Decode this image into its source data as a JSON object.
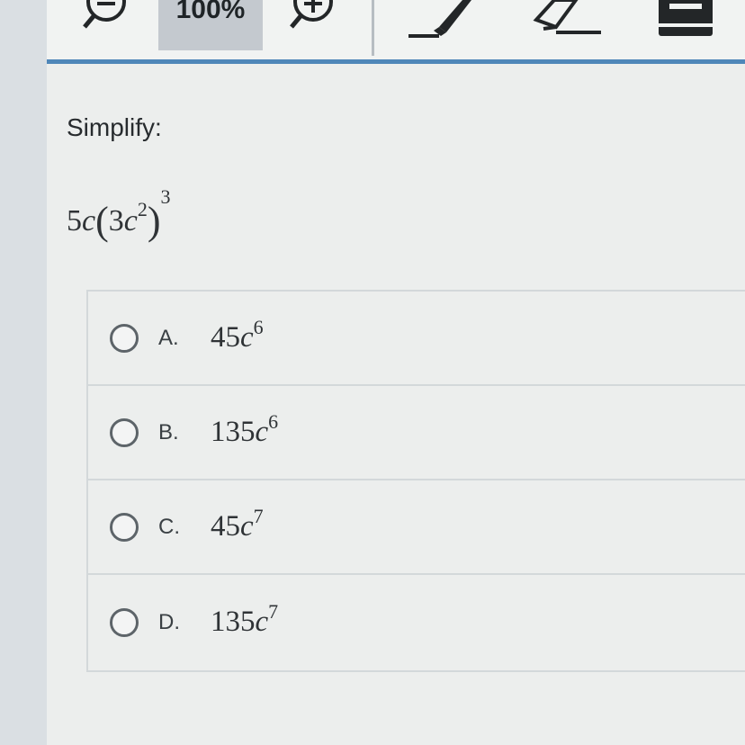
{
  "toolbar": {
    "zoom_level": "100%",
    "tools": [
      "zoom-out-icon",
      "zoom-in-icon",
      "highlighter-icon",
      "eraser-icon",
      "calculator-icon"
    ]
  },
  "colors": {
    "accent": "#4f87b9",
    "toolbar_bg": "#f1f3f2",
    "zoom_box": "#c4c9cf"
  },
  "question": {
    "prompt": "Simplify:",
    "expression": {
      "coefficient": "5",
      "variable": "c",
      "inner_coefficient": "3",
      "inner_variable": "c",
      "inner_exponent": "2",
      "outer_exponent": "3"
    }
  },
  "choices": [
    {
      "letter": "A.",
      "coefficient": "45",
      "variable": "c",
      "exponent": "6"
    },
    {
      "letter": "B.",
      "coefficient": "135",
      "variable": "c",
      "exponent": "6"
    },
    {
      "letter": "C.",
      "coefficient": "45",
      "variable": "c",
      "exponent": "7"
    },
    {
      "letter": "D.",
      "coefficient": "135",
      "variable": "c",
      "exponent": "7"
    }
  ]
}
